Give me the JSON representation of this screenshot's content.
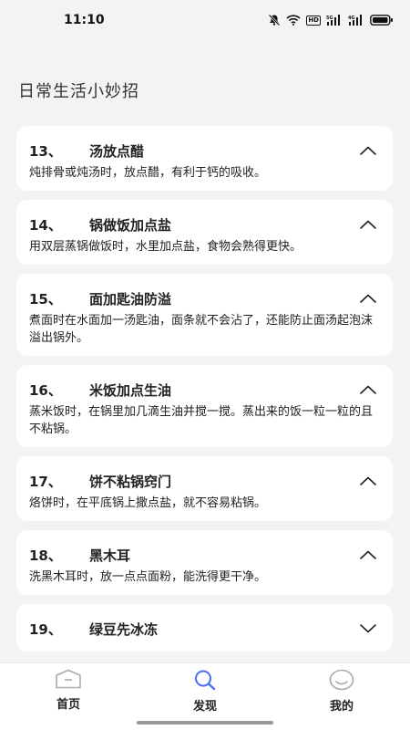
{
  "status_bar": {
    "time": "11:10",
    "hd_badge": "HD",
    "signal1_label": "5G",
    "signal2_label": "4G",
    "icons": [
      "bell-muted-icon",
      "wifi-icon",
      "hd-icon",
      "signal-5g-icon",
      "signal-4g-icon",
      "battery-icon"
    ]
  },
  "page": {
    "title": "日常生活小妙招"
  },
  "tips": [
    {
      "num": "13、",
      "title": "汤放点醋",
      "body": "炖排骨或炖汤时，放点醋，有利于钙的吸收。",
      "expanded": true
    },
    {
      "num": "14、",
      "title": "锅做饭加点盐",
      "body": "用双层蒸锅做饭时，水里加点盐，食物会熟得更快。",
      "expanded": true
    },
    {
      "num": "15、",
      "title": "面加匙油防溢",
      "body": "煮面时在水面加一汤匙油，面条就不会沾了，还能防止面汤起泡沫溢出锅外。",
      "expanded": true
    },
    {
      "num": "16、",
      "title": "米饭加点生油",
      "body": "蒸米饭时，在锅里加几滴生油并搅一搅。蒸出来的饭一粒一粒的且不粘锅。",
      "expanded": true
    },
    {
      "num": "17、",
      "title": "饼不粘锅窍门",
      "body": "烙饼时，在平底锅上撒点盐，就不容易粘锅。",
      "expanded": true
    },
    {
      "num": "18、",
      "title": "黑木耳",
      "body": "洗黑木耳时，放一点点面粉，能洗得更干净。",
      "expanded": true
    },
    {
      "num": "19、",
      "title": "绿豆先冰冻",
      "body": "",
      "expanded": false
    }
  ],
  "bottom_nav": {
    "items": [
      {
        "label": "首页",
        "icon": "home-icon",
        "active": false
      },
      {
        "label": "发现",
        "icon": "search-icon",
        "active": true
      },
      {
        "label": "我的",
        "icon": "smiley-icon",
        "active": false
      }
    ]
  },
  "colors": {
    "accent": "#4a6cf7",
    "icon_gray": "#aaaaaa",
    "background": "#f3f3f5"
  }
}
